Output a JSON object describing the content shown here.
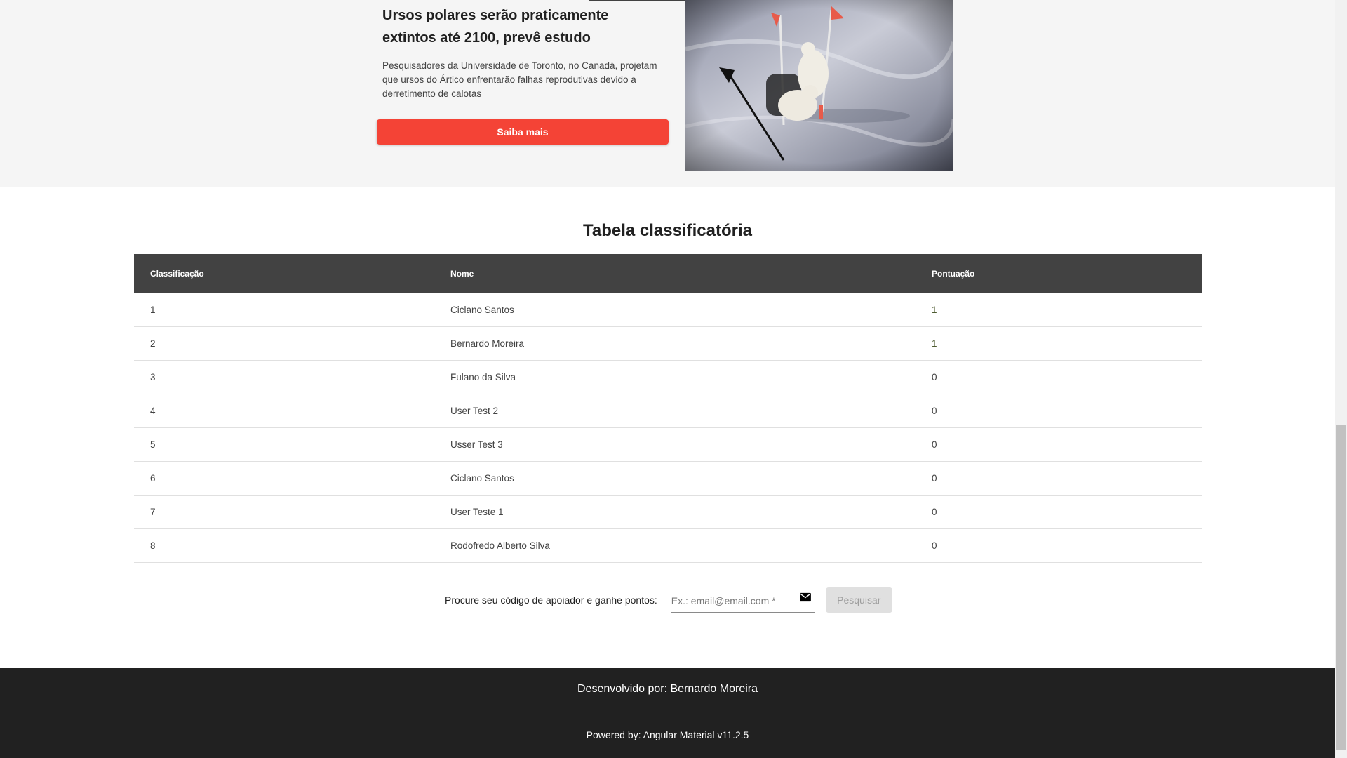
{
  "news": {
    "title": "Ursos polares serão praticamente extintos até 2100, prevê estudo",
    "text": "Pesquisadores da Universidade de Toronto, no Canadá, projetam que ursos do Ártico enfrentarão falhas reprodutivas devido a derretimento de calotas",
    "button_label": "Saiba mais",
    "image_icon": "polar-bears-photo"
  },
  "ranking": {
    "title": "Tabela classificatória",
    "columns": [
      "Classificação",
      "Nome",
      "Pontuação"
    ],
    "rows": [
      {
        "pos": "1",
        "name": "Ciclano Santos",
        "score": "1"
      },
      {
        "pos": "2",
        "name": "Bernardo Moreira",
        "score": "1"
      },
      {
        "pos": "3",
        "name": "Fulano da Silva",
        "score": "0"
      },
      {
        "pos": "4",
        "name": "User Test 2",
        "score": "0"
      },
      {
        "pos": "5",
        "name": "Usser Test 3",
        "score": "0"
      },
      {
        "pos": "6",
        "name": "Ciclano Santos",
        "score": "0"
      },
      {
        "pos": "7",
        "name": "User Teste 1",
        "score": "0"
      },
      {
        "pos": "8",
        "name": "Rodofredo Alberto Silva",
        "score": "0"
      }
    ]
  },
  "search": {
    "label": "Procure seu código de apoiador e ganhe pontos:",
    "placeholder": "Ex.: email@email.com *",
    "value": "",
    "icon": "mail-icon",
    "button_label": "Pesquisar"
  },
  "footer": {
    "developed_by": "Desenvolvido por: Bernardo Moreira",
    "powered_by": "Powered by: Angular Material v11.2.5"
  },
  "colors": {
    "accent": "#f44336",
    "table_header": "#424242",
    "footer_bg": "#212121",
    "section_bg": "#f5f5f5"
  }
}
